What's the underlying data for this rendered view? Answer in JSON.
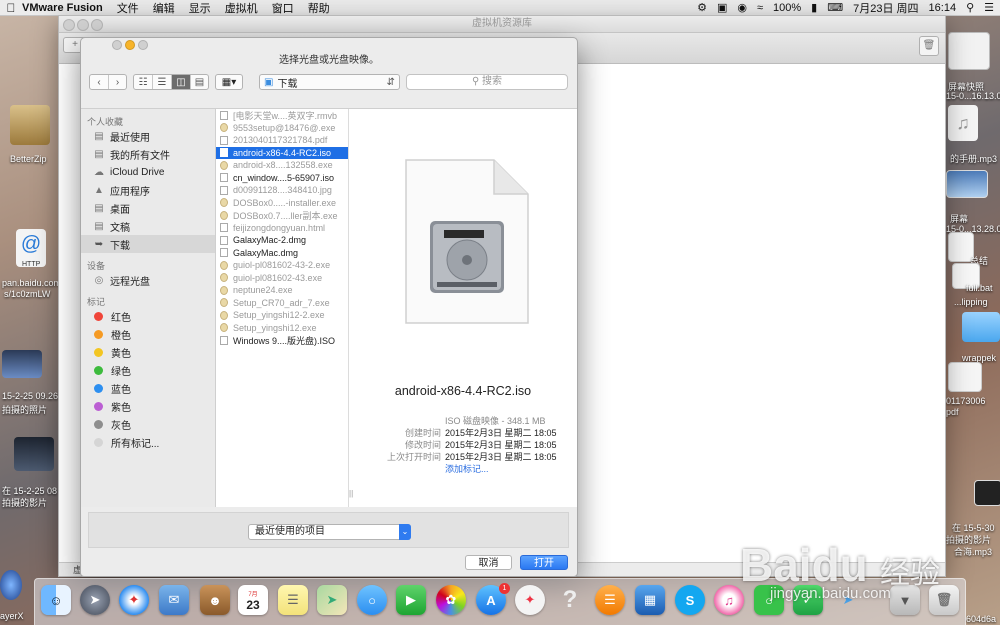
{
  "menubar": {
    "app_name": "VMware Fusion",
    "menus": [
      "文件",
      "编辑",
      "显示",
      "虚拟机",
      "窗口",
      "帮助"
    ],
    "battery": "100%",
    "date": "7月23日 周四",
    "time": "16:14"
  },
  "desktop_left": [
    "BetterZip",
    "HTTP",
    "pan.baidu.com",
    "s/1c0zmLW",
    "15-2-25 09.26",
    "拍摄的照片",
    "在 15-2-25 08",
    "拍摄的影片",
    "ayerX"
  ],
  "desktop_right": [
    "屏幕快照",
    "15-0...16.13.0",
    "的手册.mp3",
    "屏幕",
    "15-0...13.28.03",
    "总结",
    "full.bat",
    "...lipping",
    "wrappek",
    "01173006",
    "pdf",
    "在 15-5-30",
    "拍摄的影片",
    "合海.mp3",
    "604d6a"
  ],
  "bg_window": {
    "title": "虚拟机资源库",
    "add_label": "+",
    "bottom_label": "虚"
  },
  "dialog": {
    "title": "选择光盘或光盘映像。",
    "location": "下载",
    "search_placeholder": "搜索",
    "sidebar": {
      "favorites_header": "个人收藏",
      "favorites": [
        {
          "label": "最近使用",
          "icon": "recents-icon"
        },
        {
          "label": "我的所有文件",
          "icon": "all-files-icon"
        },
        {
          "label": "iCloud Drive",
          "icon": "cloud-icon"
        },
        {
          "label": "应用程序",
          "icon": "applications-icon"
        },
        {
          "label": "桌面",
          "icon": "desktop-icon"
        },
        {
          "label": "文稿",
          "icon": "documents-icon"
        },
        {
          "label": "下载",
          "icon": "downloads-icon"
        }
      ],
      "devices_header": "设备",
      "devices": [
        {
          "label": "远程光盘",
          "icon": "disc-icon"
        }
      ],
      "tags_header": "标记",
      "tags": [
        {
          "label": "红色",
          "color": "#f0453a"
        },
        {
          "label": "橙色",
          "color": "#f59a23"
        },
        {
          "label": "黄色",
          "color": "#f3c622"
        },
        {
          "label": "绿色",
          "color": "#3dbb3d"
        },
        {
          "label": "蓝色",
          "color": "#2d8ff0"
        },
        {
          "label": "紫色",
          "color": "#bb5fd3"
        },
        {
          "label": "灰色",
          "color": "#8e8e8e"
        },
        {
          "label": "所有标记...",
          "color": "#d5d5d5"
        }
      ]
    },
    "files": [
      {
        "name": "[电影天堂w....英双字.rmvb",
        "dim": true,
        "type": "doc"
      },
      {
        "name": "9553setup@18476@.exe",
        "dim": true,
        "type": "exe"
      },
      {
        "name": "2013040117321784.pdf",
        "dim": true,
        "type": "doc"
      },
      {
        "name": "android-x86-4.4-RC2.iso",
        "dim": false,
        "type": "doc",
        "selected": true
      },
      {
        "name": "android-x8....132558.exe",
        "dim": true,
        "type": "exe"
      },
      {
        "name": "cn_window....5-65907.iso",
        "dim": false,
        "type": "doc"
      },
      {
        "name": "d00991128....348410.jpg",
        "dim": true,
        "type": "doc"
      },
      {
        "name": "DOSBox0.....-installer.exe",
        "dim": true,
        "type": "exe"
      },
      {
        "name": "DOSBox0.7....ller副本.exe",
        "dim": true,
        "type": "exe"
      },
      {
        "name": "feijizongdongyuan.html",
        "dim": true,
        "type": "doc"
      },
      {
        "name": "GalaxyMac-2.dmg",
        "dim": false,
        "type": "doc"
      },
      {
        "name": "GalaxyMac.dmg",
        "dim": false,
        "type": "doc"
      },
      {
        "name": "guiol-pl081602-43-2.exe",
        "dim": true,
        "type": "exe"
      },
      {
        "name": "guiol-pl081602-43.exe",
        "dim": true,
        "type": "exe"
      },
      {
        "name": "neptune24.exe",
        "dim": true,
        "type": "exe"
      },
      {
        "name": "Setup_CR70_adr_7.exe",
        "dim": true,
        "type": "exe"
      },
      {
        "name": "Setup_yingshi12-2.exe",
        "dim": true,
        "type": "exe"
      },
      {
        "name": "Setup_yingshi12.exe",
        "dim": true,
        "type": "exe"
      },
      {
        "name": "Windows 9....版光盘).ISO",
        "dim": false,
        "type": "doc"
      }
    ],
    "preview": {
      "name": "android-x86-4.4-RC2.iso",
      "kind": "ISO 磁盘映像 - 348.1 MB",
      "created_label": "创建时间",
      "created": "2015年2月3日 星期二 18:05",
      "modified_label": "修改时间",
      "modified": "2015年2月3日 星期二 18:05",
      "opened_label": "上次打开时间",
      "opened": "2015年2月3日 星期二 18:05",
      "add_tags": "添加标记..."
    },
    "option_select": "最近使用的项目",
    "cancel_label": "取消",
    "open_label": "打开"
  },
  "dock": {
    "calendar_month": "7月",
    "calendar_day": "23",
    "badge": "1"
  },
  "watermark": {
    "brand": "Baidu",
    "sub": "jingyan.baidu.com",
    "cn": "经验"
  }
}
